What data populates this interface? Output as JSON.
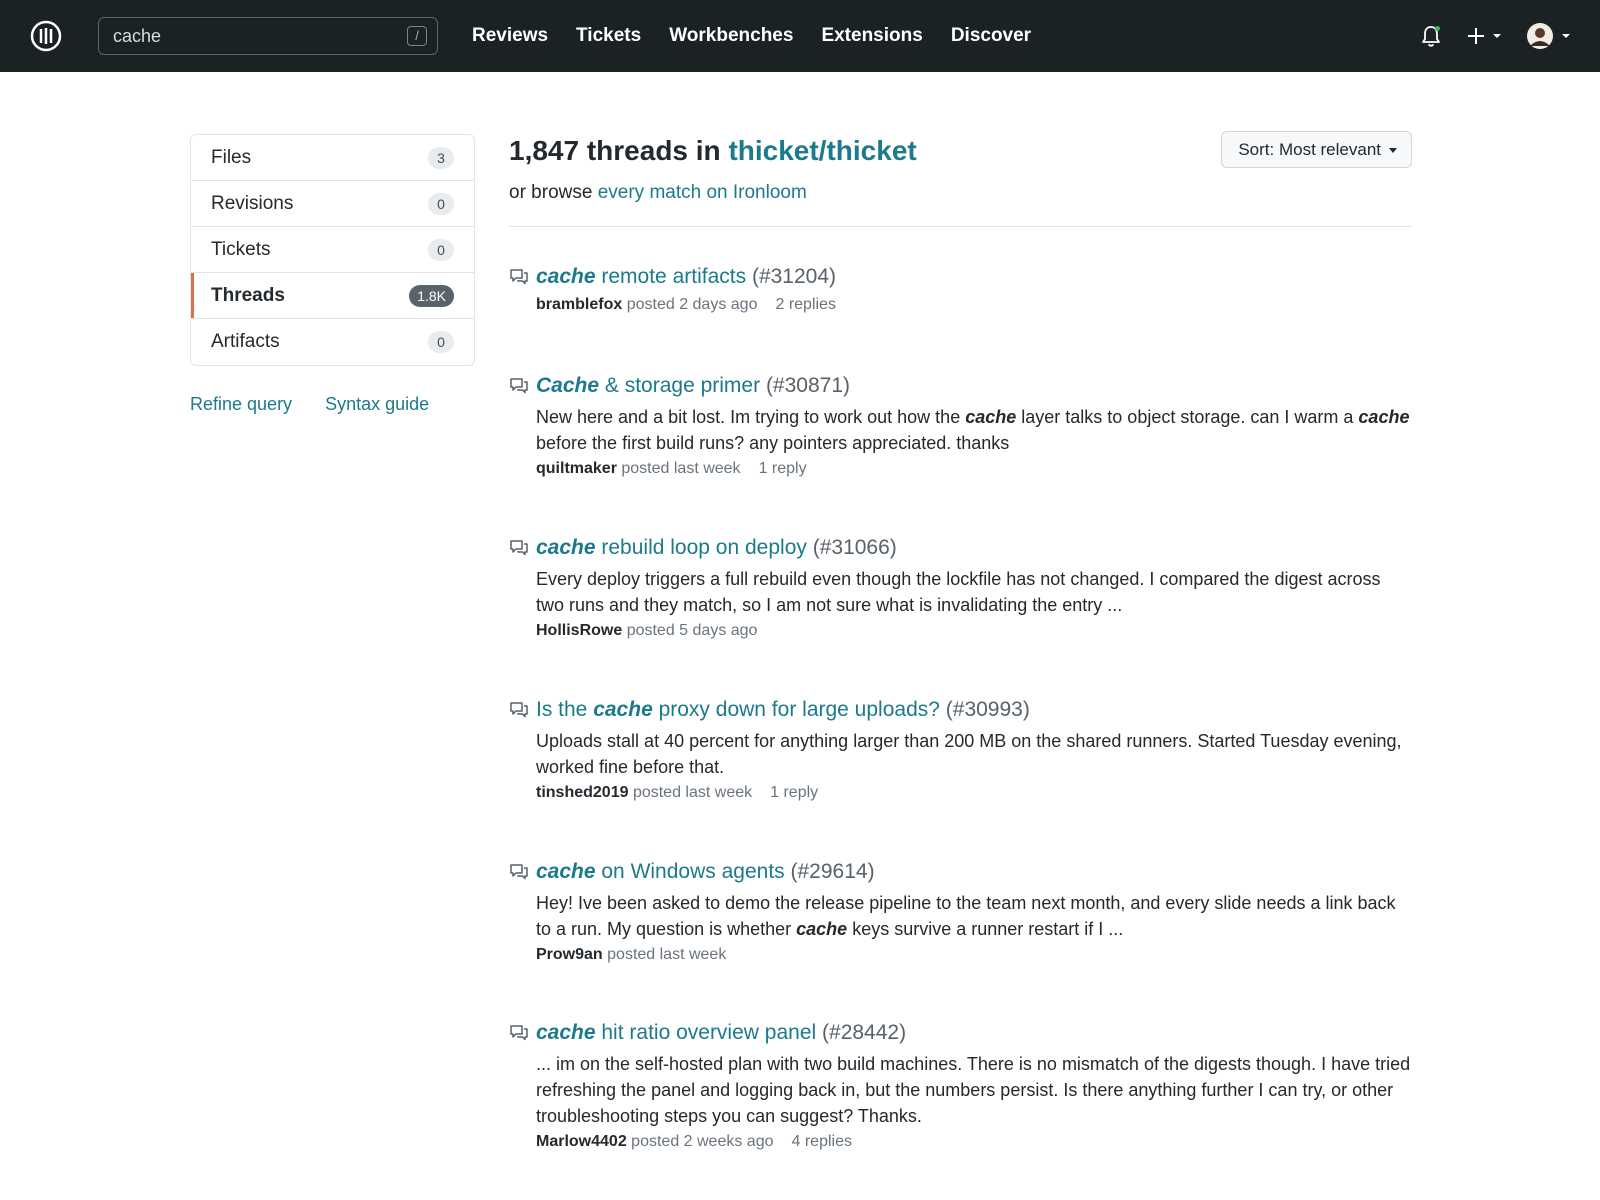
{
  "header": {
    "search_value": "cache",
    "search_shortcut": "/",
    "nav": [
      "Reviews",
      "Tickets",
      "Workbenches",
      "Extensions",
      "Discover"
    ]
  },
  "sidebar": {
    "items": [
      {
        "label": "Files",
        "count": "3",
        "active": false
      },
      {
        "label": "Revisions",
        "count": "0",
        "active": false
      },
      {
        "label": "Tickets",
        "count": "0",
        "active": false
      },
      {
        "label": "Threads",
        "count": "1.8K",
        "active": true
      },
      {
        "label": "Artifacts",
        "count": "0",
        "active": false
      }
    ],
    "links": [
      "Refine query",
      "Syntax guide"
    ]
  },
  "main": {
    "title_prefix": "1,847 threads in ",
    "repo": "thicket/thicket",
    "browse_prefix": "or browse ",
    "browse_link": "every match on Ironloom",
    "sort_label": "Sort: Most relevant"
  },
  "results": [
    {
      "title_parts": [
        {
          "t": "cache",
          "hl": true
        },
        {
          "t": " remote artifacts",
          "hl": false
        }
      ],
      "number": "(#31204)",
      "snippet_parts": [],
      "author": "bramblefox",
      "posted": "posted 2 days ago",
      "replies": "2 replies"
    },
    {
      "title_parts": [
        {
          "t": "Cache",
          "hl": true
        },
        {
          "t": " & storage primer",
          "hl": false
        }
      ],
      "number": "(#30871)",
      "snippet_parts": [
        {
          "t": "New here and a bit lost. Im trying to work out how the ",
          "hl": false
        },
        {
          "t": "cache",
          "hl": true
        },
        {
          "t": " layer talks to object storage. can I warm a ",
          "hl": false
        },
        {
          "t": "cache",
          "hl": true
        },
        {
          "t": " before the first build runs? any pointers appreciated. thanks",
          "hl": false
        }
      ],
      "author": "quiltmaker",
      "posted": "posted last week",
      "replies": "1 reply"
    },
    {
      "title_parts": [
        {
          "t": "cache",
          "hl": true
        },
        {
          "t": " rebuild loop on deploy",
          "hl": false
        }
      ],
      "number": "(#31066)",
      "snippet_parts": [
        {
          "t": "Every deploy triggers a full rebuild even though the lockfile has not changed. I compared the digest across two runs and they match, so I am not sure what is invalidating the entry ...",
          "hl": false
        }
      ],
      "author": "HollisRowe",
      "posted": "posted 5 days ago",
      "replies": ""
    },
    {
      "title_parts": [
        {
          "t": "Is the ",
          "hl": false
        },
        {
          "t": "cache",
          "hl": true
        },
        {
          "t": " proxy down for large uploads?",
          "hl": false
        }
      ],
      "number": "(#30993)",
      "snippet_parts": [
        {
          "t": "Uploads stall at 40 percent for anything larger than 200 MB on the shared runners. Started Tuesday evening, worked fine before that.",
          "hl": false
        }
      ],
      "author": "tinshed2019",
      "posted": "posted last week",
      "replies": "1 reply"
    },
    {
      "title_parts": [
        {
          "t": "cache",
          "hl": true
        },
        {
          "t": " on Windows agents",
          "hl": false
        }
      ],
      "number": "(#29614)",
      "snippet_parts": [
        {
          "t": "Hey! Ive been asked to demo the release pipeline to the team next month, and every slide needs a link back to a run. My question is whether ",
          "hl": false
        },
        {
          "t": "cache",
          "hl": true
        },
        {
          "t": " keys survive a runner restart if I ...",
          "hl": false
        }
      ],
      "author": "Prow9an",
      "posted": "posted last week",
      "replies": ""
    },
    {
      "title_parts": [
        {
          "t": "cache",
          "hl": true
        },
        {
          "t": " hit ratio overview panel",
          "hl": false
        }
      ],
      "number": "(#28442)",
      "snippet_parts": [
        {
          "t": "... im on the self-hosted plan with two build machines. There is no mismatch of the digests though. I have tried refreshing the panel and logging back in, but the numbers persist. Is there anything further I can try, or other troubleshooting steps you can suggest? Thanks.",
          "hl": false
        }
      ],
      "author": "Marlow4402",
      "posted": "posted 2 weeks ago",
      "replies": "4 replies"
    }
  ]
}
